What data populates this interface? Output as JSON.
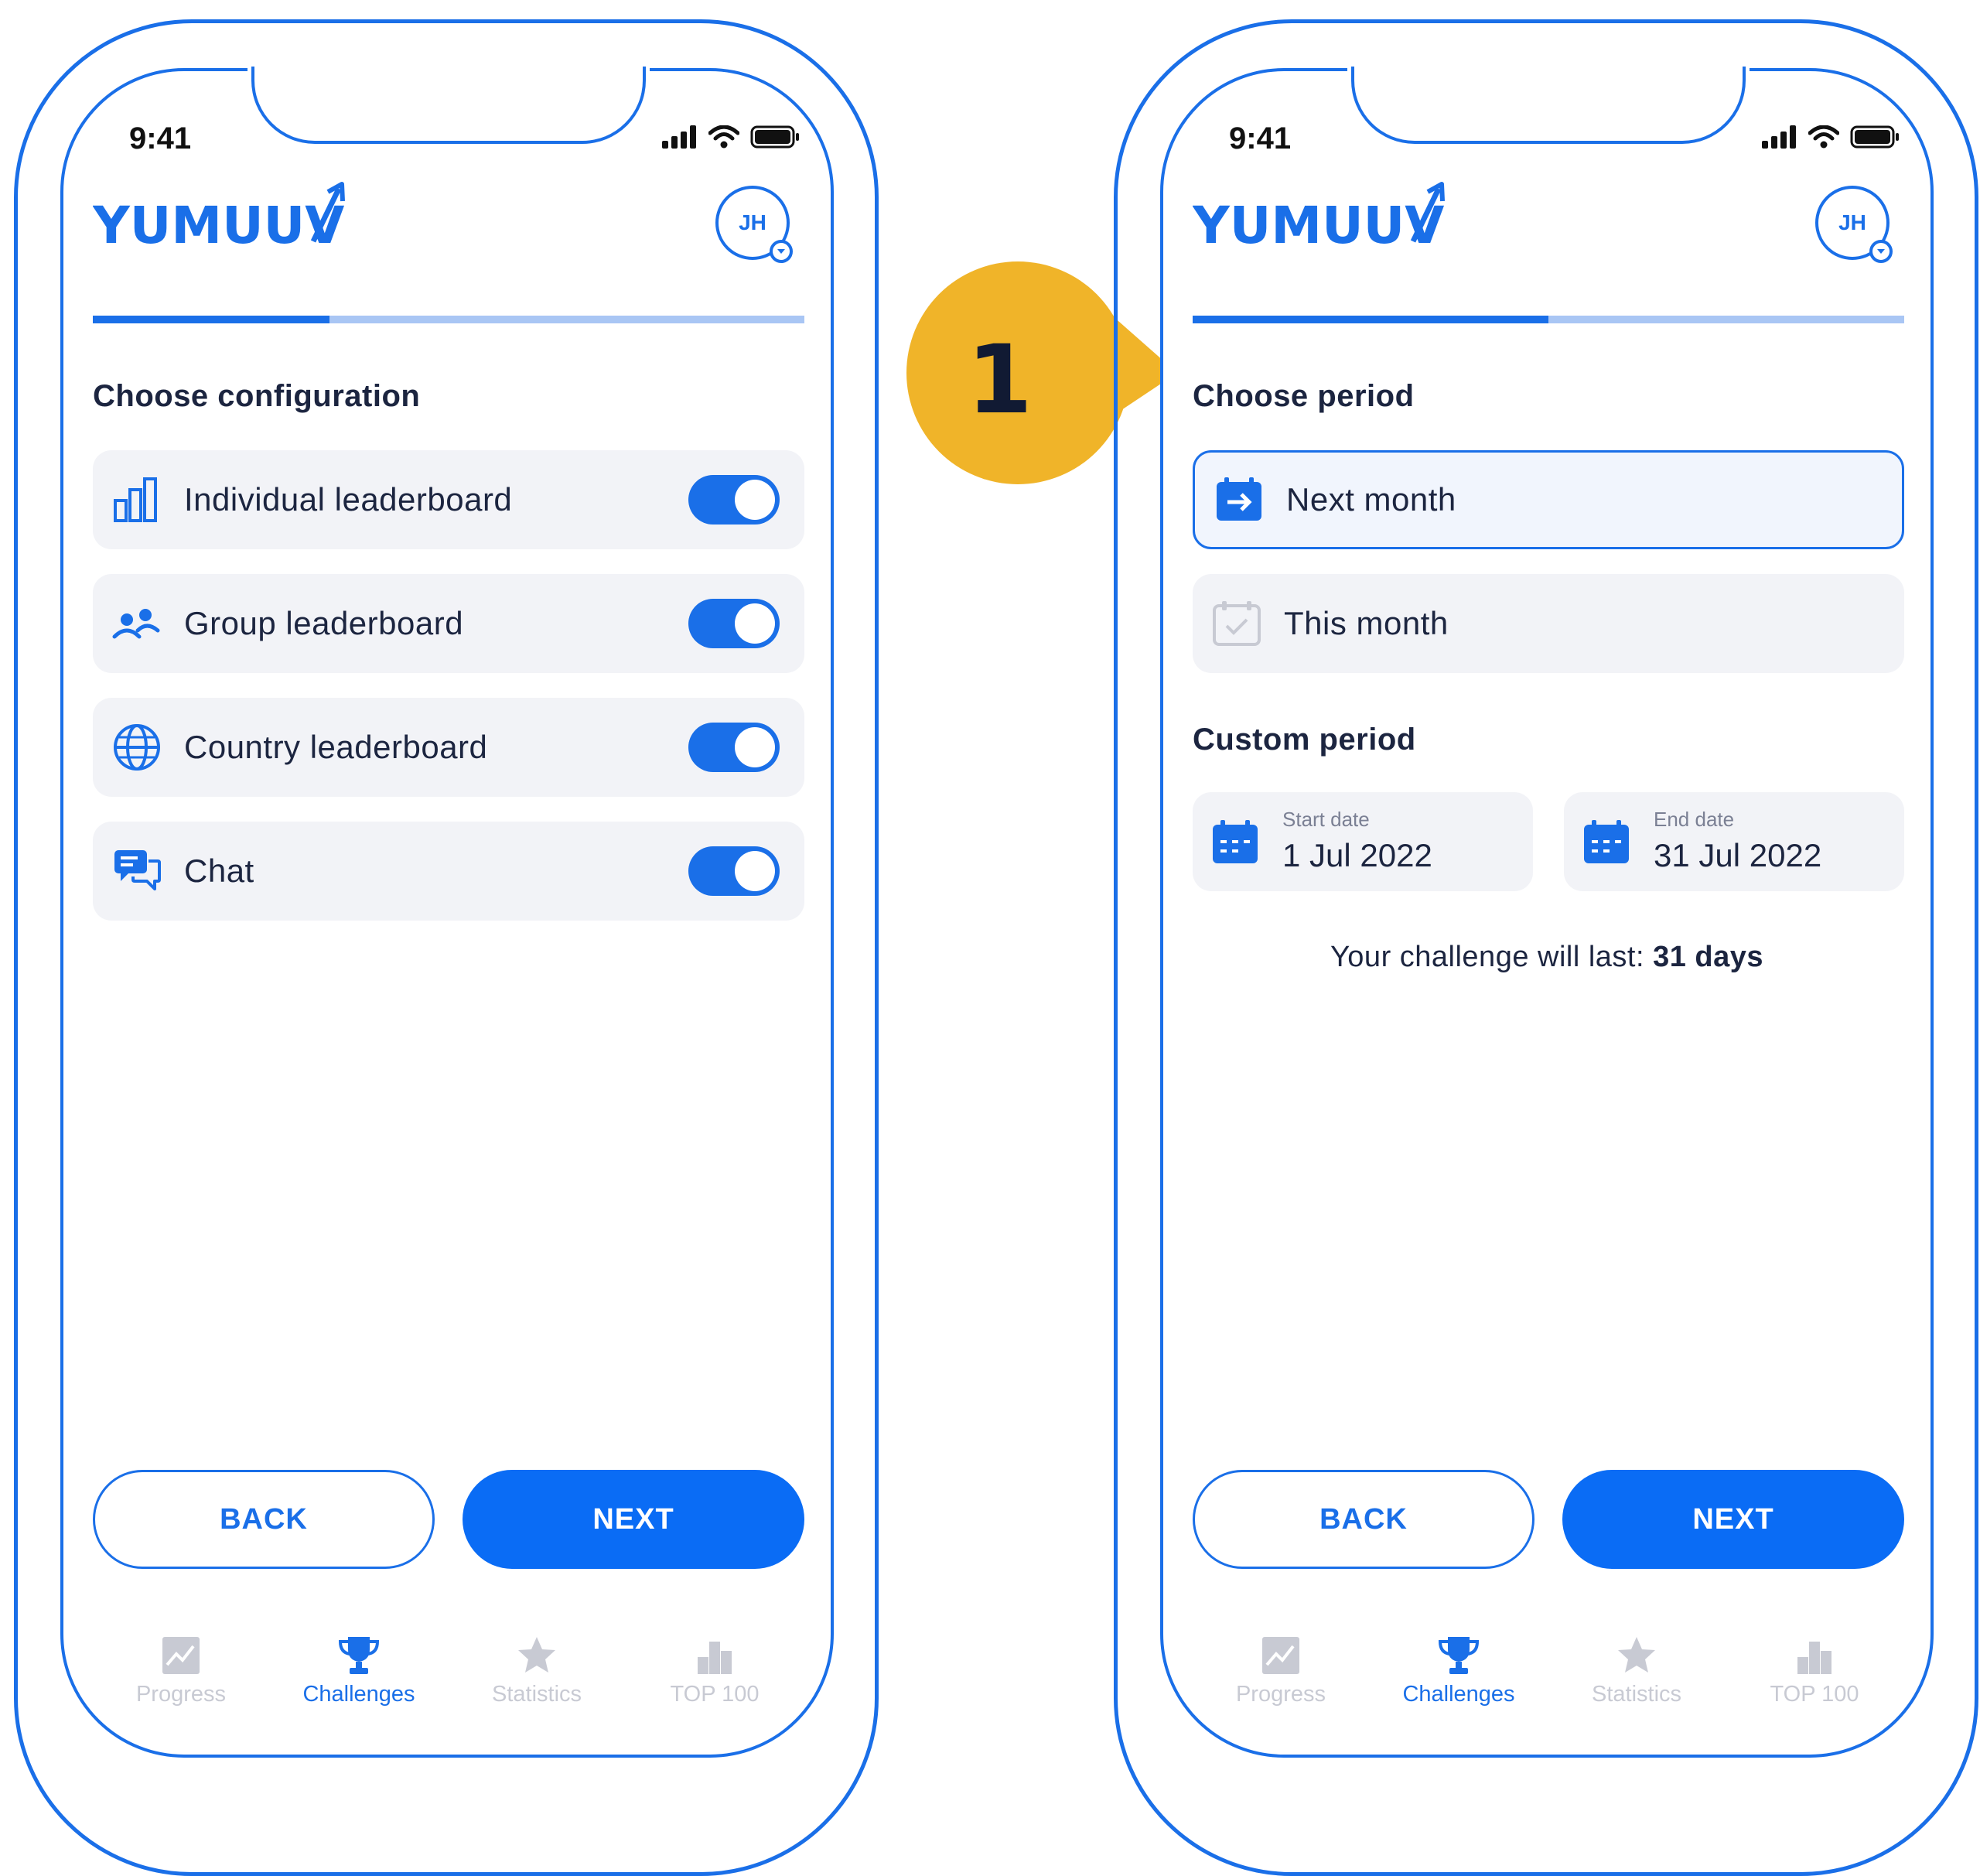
{
  "left_screen": {
    "status_time": "9:41",
    "logo_text": "YUMUUV",
    "avatar_initials": "JH",
    "progress_fraction": 0.333,
    "section_title": "Choose configuration",
    "options": [
      {
        "label": "Individual leaderboard",
        "icon": "bar-chart-icon",
        "enabled": true
      },
      {
        "label": "Group leaderboard",
        "icon": "group-icon",
        "enabled": true
      },
      {
        "label": "Country leaderboard",
        "icon": "globe-icon",
        "enabled": true
      },
      {
        "label": "Chat",
        "icon": "chat-icon",
        "enabled": true
      }
    ],
    "back_label": "BACK",
    "next_label": "NEXT"
  },
  "right_screen": {
    "status_time": "9:41",
    "logo_text": "YUMUUV",
    "avatar_initials": "JH",
    "progress_fraction": 0.5,
    "section_title": "Choose period",
    "period_options": [
      {
        "label": "Next month",
        "icon": "calendar-arrow-icon",
        "selected": true
      },
      {
        "label": "This month",
        "icon": "calendar-check-icon",
        "selected": false
      }
    ],
    "custom_title": "Custom period",
    "start_date_label": "Start date",
    "start_date_value": "1 Jul 2022",
    "end_date_label": "End date",
    "end_date_value": "31 Jul 2022",
    "duration_prefix": "Your challenge will last:",
    "duration_value": "31 days",
    "back_label": "BACK",
    "next_label": "NEXT"
  },
  "tabs": [
    {
      "label": "Progress",
      "icon": "progress-chart-icon",
      "active": false
    },
    {
      "label": "Challenges",
      "icon": "trophy-icon",
      "active": true
    },
    {
      "label": "Statistics",
      "icon": "star-icon",
      "active": false
    },
    {
      "label": "TOP 100",
      "icon": "podium-icon",
      "active": false
    }
  ],
  "callout": {
    "number": "1"
  },
  "colors": {
    "primary": "#1a6fe8",
    "callout": "#f0b429",
    "row_bg": "#f2f3f7",
    "inactive": "#c8cad3"
  }
}
